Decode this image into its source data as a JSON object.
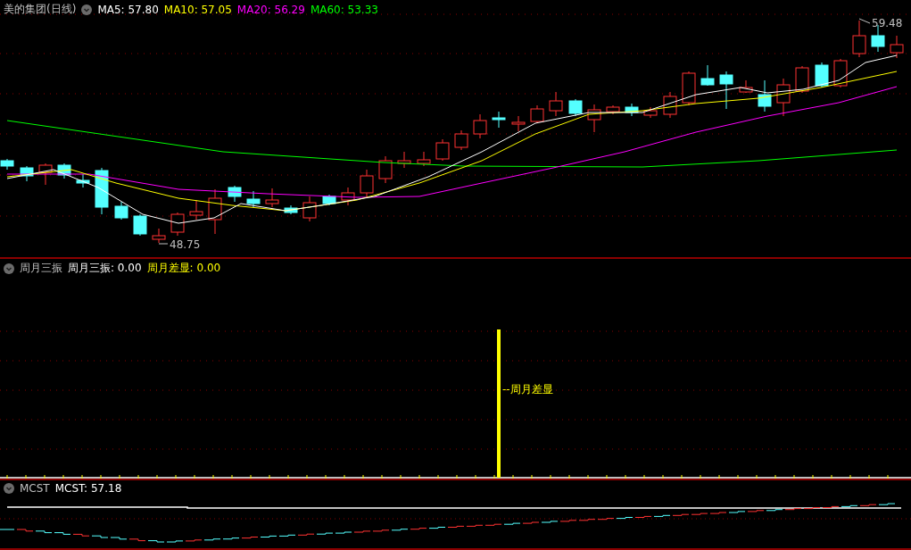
{
  "main_pane": {
    "title": "美的集团(日线)",
    "averages": [
      {
        "text": "MA5: 57.80",
        "color": "#ffffff"
      },
      {
        "text": "MA10: 57.05",
        "color": "#ffff00"
      },
      {
        "text": "MA20: 56.29",
        "color": "#ff00ff"
      },
      {
        "text": "MA60: 53.33",
        "color": "#00ff00"
      }
    ],
    "high_label": "59.48",
    "low_label": "48.75"
  },
  "indicator_pane": {
    "title": "周月三振",
    "values": [
      {
        "text": "周月三振: 0.00",
        "color": "#ffffff"
      },
      {
        "text": "周月差显: 0.00",
        "color": "#ffff00"
      }
    ],
    "bar_label": "--周月差显"
  },
  "mcst_pane": {
    "title": "MCST",
    "values": [
      {
        "text": "MCST: 57.18",
        "color": "#ffffff"
      }
    ]
  }
}
